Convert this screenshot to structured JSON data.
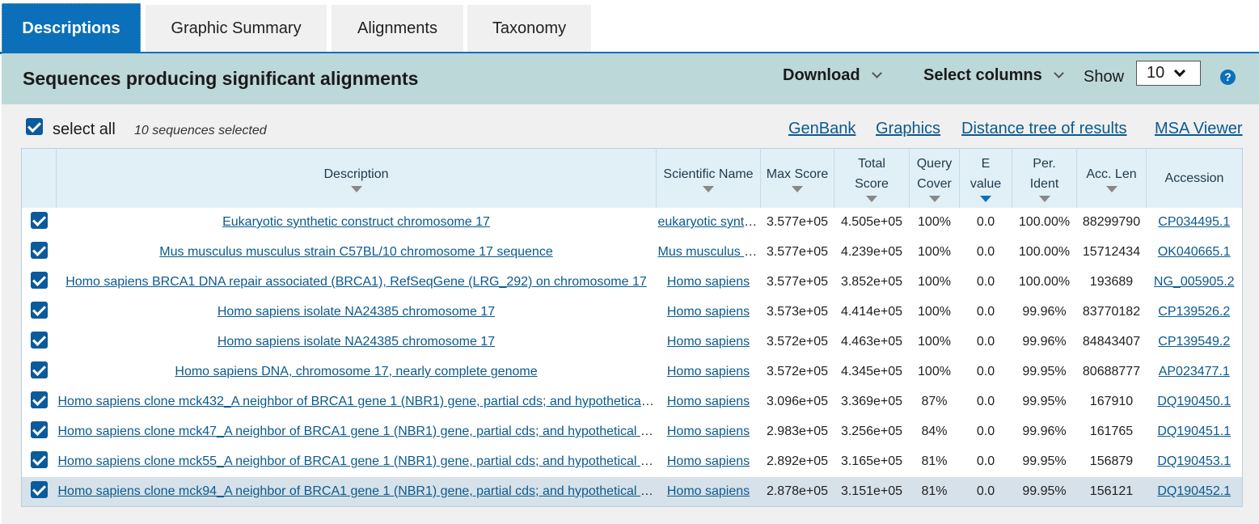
{
  "tabs": [
    {
      "label": "Descriptions",
      "active": true
    },
    {
      "label": "Graphic Summary",
      "active": false
    },
    {
      "label": "Alignments",
      "active": false
    },
    {
      "label": "Taxonomy",
      "active": false
    }
  ],
  "header": {
    "title": "Sequences producing significant alignments",
    "download_label": "Download",
    "select_columns_label": "Select columns",
    "show_label": "Show",
    "show_value": "10",
    "help_icon": "?"
  },
  "selection": {
    "select_all_label": "select all",
    "count_text": "10 sequences selected"
  },
  "links": {
    "genbank": "GenBank",
    "graphics": "Graphics",
    "distance_tree": "Distance tree of results",
    "msa_viewer": "MSA Viewer"
  },
  "columns": {
    "description": "Description",
    "scientific_name": "Scientific Name",
    "max_score": "Max Score",
    "total_score_1": "Total",
    "total_score_2": "Score",
    "query_cover_1": "Query",
    "query_cover_2": "Cover",
    "evalue_1": "E",
    "evalue_2": "value",
    "per_ident_1": "Per.",
    "per_ident_2": "Ident",
    "acc_len": "Acc. Len",
    "accession": "Accession"
  },
  "colors": {
    "accent": "#0b70b9",
    "header_band": "#bcd8d8",
    "link": "#0b5a8d",
    "selected_row": "#d6e1ea"
  },
  "rows": [
    {
      "description": "Eukaryotic synthetic construct chromosome 17",
      "scientific_name": "eukaryotic synthetic construct",
      "max_score": "3.577e+05",
      "total_score": "4.505e+05",
      "query_cover": "100%",
      "evalue": "0.0",
      "per_ident": "100.00%",
      "acc_len": "88299790",
      "accession": "CP034495.1"
    },
    {
      "description": "Mus musculus musculus strain C57BL/10 chromosome 17 sequence",
      "scientific_name": "Mus musculus musculus",
      "max_score": "3.577e+05",
      "total_score": "4.239e+05",
      "query_cover": "100%",
      "evalue": "0.0",
      "per_ident": "100.00%",
      "acc_len": "15712434",
      "accession": "OK040665.1"
    },
    {
      "description": "Homo sapiens BRCA1 DNA repair associated (BRCA1), RefSeqGene (LRG_292) on chromosome 17",
      "scientific_name": "Homo sapiens",
      "max_score": "3.577e+05",
      "total_score": "3.852e+05",
      "query_cover": "100%",
      "evalue": "0.0",
      "per_ident": "100.00%",
      "acc_len": "193689",
      "accession": "NG_005905.2"
    },
    {
      "description": "Homo sapiens isolate NA24385 chromosome 17",
      "scientific_name": "Homo sapiens",
      "max_score": "3.573e+05",
      "total_score": "4.414e+05",
      "query_cover": "100%",
      "evalue": "0.0",
      "per_ident": "99.96%",
      "acc_len": "83770182",
      "accession": "CP139526.2"
    },
    {
      "description": "Homo sapiens isolate NA24385 chromosome 17",
      "scientific_name": "Homo sapiens",
      "max_score": "3.572e+05",
      "total_score": "4.463e+05",
      "query_cover": "100%",
      "evalue": "0.0",
      "per_ident": "99.96%",
      "acc_len": "84843407",
      "accession": "CP139549.2"
    },
    {
      "description": "Homo sapiens DNA, chromosome 17, nearly complete genome",
      "scientific_name": "Homo sapiens",
      "max_score": "3.572e+05",
      "total_score": "4.345e+05",
      "query_cover": "100%",
      "evalue": "0.0",
      "per_ident": "99.95%",
      "acc_len": "80688777",
      "accession": "AP023477.1"
    },
    {
      "description": "Homo sapiens clone mck432_A neighbor of BRCA1 gene 1 (NBR1) gene, partial cds; and hypothetical protein",
      "scientific_name": "Homo sapiens",
      "max_score": "3.096e+05",
      "total_score": "3.369e+05",
      "query_cover": "87%",
      "evalue": "0.0",
      "per_ident": "99.95%",
      "acc_len": "167910",
      "accession": "DQ190450.1"
    },
    {
      "description": "Homo sapiens clone mck47_A neighbor of BRCA1 gene 1 (NBR1) gene, partial cds; and hypothetical protein",
      "scientific_name": "Homo sapiens",
      "max_score": "2.983e+05",
      "total_score": "3.256e+05",
      "query_cover": "84%",
      "evalue": "0.0",
      "per_ident": "99.96%",
      "acc_len": "161765",
      "accession": "DQ190451.1"
    },
    {
      "description": "Homo sapiens clone mck55_A neighbor of BRCA1 gene 1 (NBR1) gene, partial cds; and hypothetical protein",
      "scientific_name": "Homo sapiens",
      "max_score": "2.892e+05",
      "total_score": "3.165e+05",
      "query_cover": "81%",
      "evalue": "0.0",
      "per_ident": "99.95%",
      "acc_len": "156879",
      "accession": "DQ190453.1"
    },
    {
      "description": "Homo sapiens clone mck94_A neighbor of BRCA1 gene 1 (NBR1) gene, partial cds; and hypothetical protein",
      "scientific_name": "Homo sapiens",
      "max_score": "2.878e+05",
      "total_score": "3.151e+05",
      "query_cover": "81%",
      "evalue": "0.0",
      "per_ident": "99.95%",
      "acc_len": "156121",
      "accession": "DQ190452.1"
    }
  ]
}
